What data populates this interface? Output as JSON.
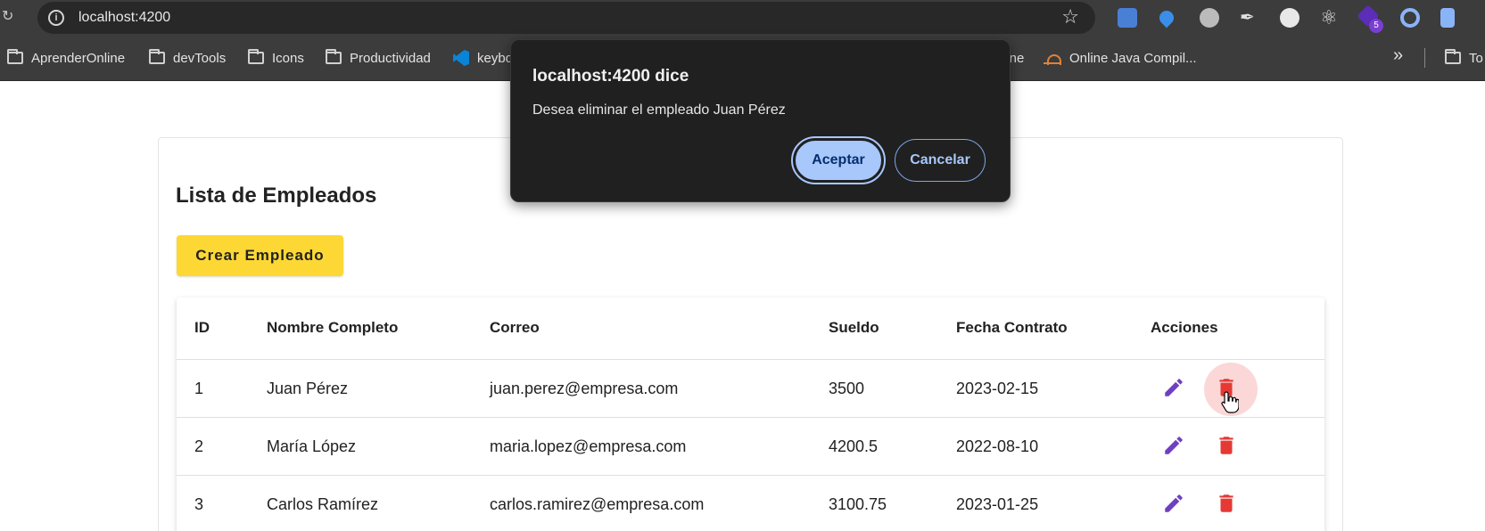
{
  "browser": {
    "url": "localhost:4200",
    "ext_badge": "5",
    "bookmarks": [
      {
        "label": "AprenderOnline",
        "icon": "folder-icon"
      },
      {
        "label": "devTools",
        "icon": "folder-icon"
      },
      {
        "label": "Icons",
        "icon": "folder-icon"
      },
      {
        "label": "Productividad",
        "icon": "folder-icon"
      },
      {
        "label": "keybo",
        "icon": "vscode-icon"
      },
      {
        "label": "One",
        "icon": "none"
      },
      {
        "label": "Online Java Compil...",
        "icon": "sunset-icon"
      },
      {
        "label": "To",
        "icon": "folder-icon"
      }
    ],
    "more_bookmarks": "»"
  },
  "page": {
    "title": "Lista de Empleados",
    "create_button": "Crear Empleado",
    "table": {
      "headers": [
        "ID",
        "Nombre Completo",
        "Correo",
        "Sueldo",
        "Fecha Contrato",
        "Acciones"
      ],
      "rows": [
        {
          "id": "1",
          "name": "Juan Pérez",
          "email": "juan.perez@empresa.com",
          "salary": "3500",
          "date": "2023-02-15"
        },
        {
          "id": "2",
          "name": "María López",
          "email": "maria.lopez@empresa.com",
          "salary": "4200.5",
          "date": "2022-08-10"
        },
        {
          "id": "3",
          "name": "Carlos Ramírez",
          "email": "carlos.ramirez@empresa.com",
          "salary": "3100.75",
          "date": "2023-01-25"
        }
      ]
    }
  },
  "dialog": {
    "title": "localhost:4200 dice",
    "message": "Desea eliminar el empleado Juan Pérez",
    "accept": "Aceptar",
    "cancel": "Cancelar"
  },
  "colors": {
    "accent_yellow": "#fdd835",
    "edit_purple": "#6f3fc2",
    "delete_red": "#e53935",
    "dialog_button": "#a8c7fa"
  }
}
